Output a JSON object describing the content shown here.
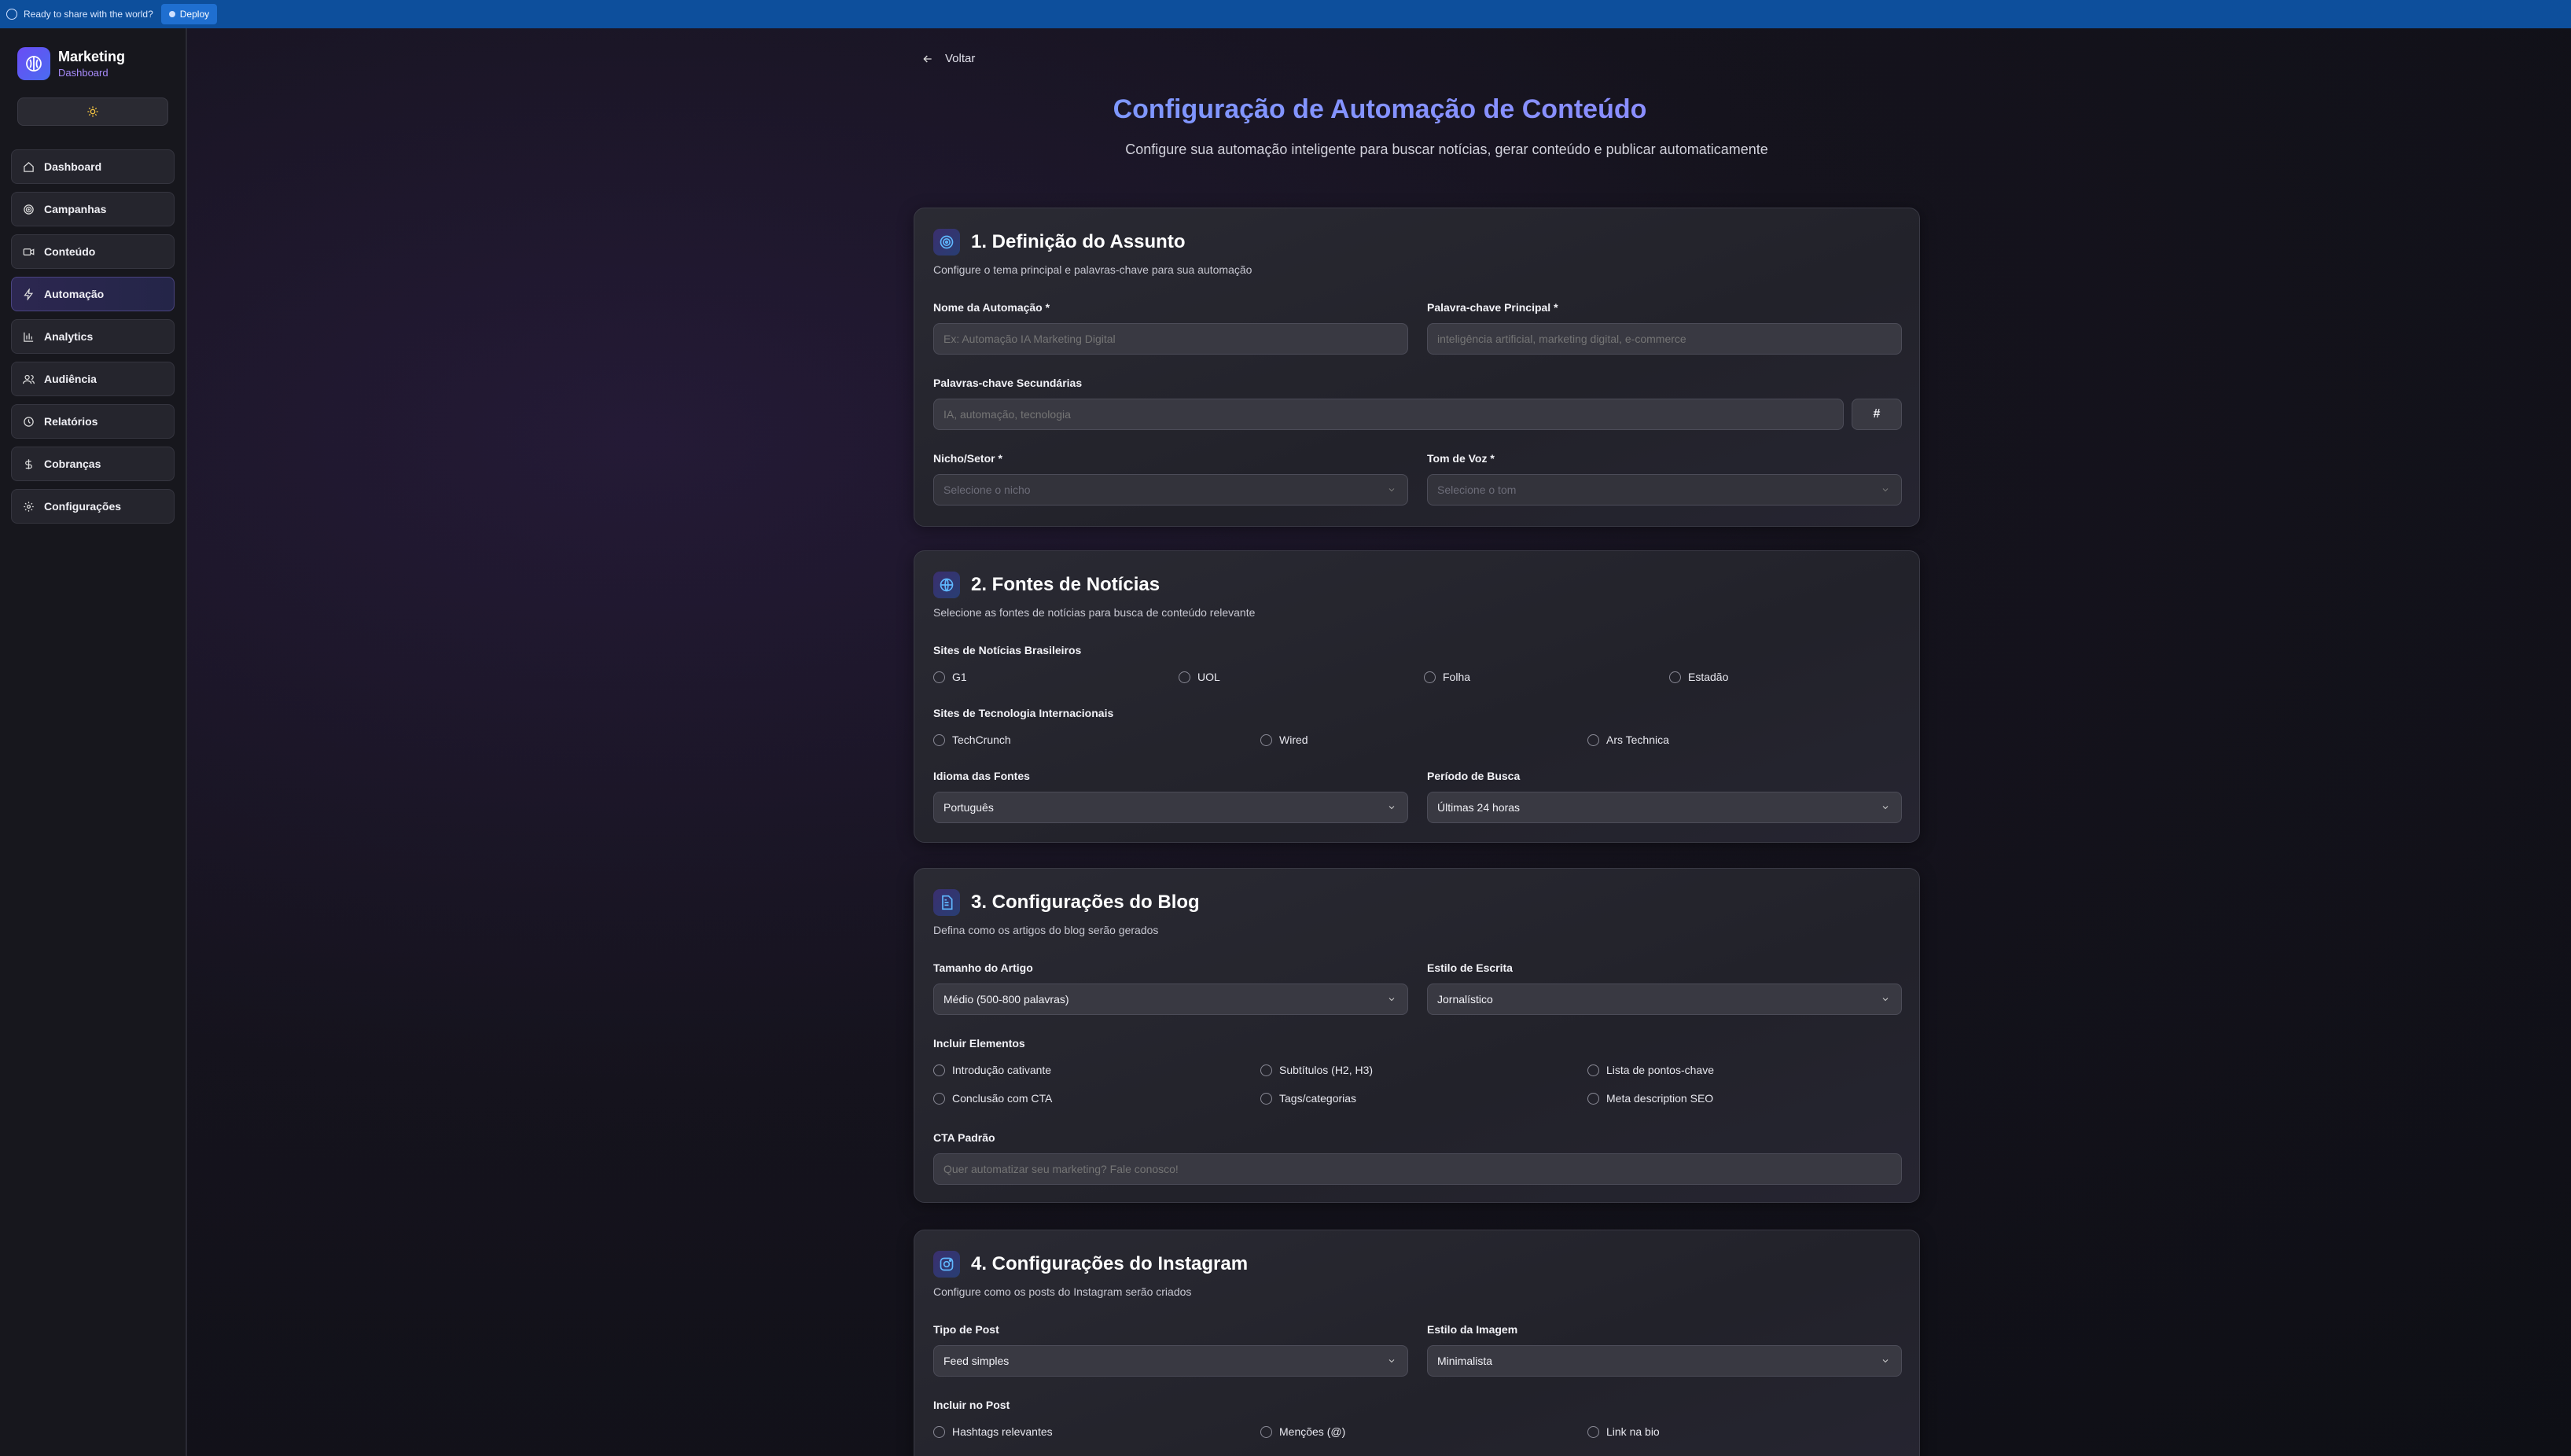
{
  "topbar": {
    "message": "Ready to share with the world?",
    "deploy_label": "Deploy"
  },
  "sidebar": {
    "brand_title": "Marketing",
    "brand_subtitle": "Dashboard",
    "items": [
      {
        "label": "Dashboard",
        "icon": "home-icon"
      },
      {
        "label": "Campanhas",
        "icon": "target-icon"
      },
      {
        "label": "Conteúdo",
        "icon": "video-icon"
      },
      {
        "label": "Automação",
        "icon": "zap-icon"
      },
      {
        "label": "Analytics",
        "icon": "bar-chart-icon"
      },
      {
        "label": "Audiência",
        "icon": "users-icon"
      },
      {
        "label": "Relatórios",
        "icon": "clock-icon"
      },
      {
        "label": "Cobranças",
        "icon": "dollar-icon"
      },
      {
        "label": "Configurações",
        "icon": "gear-icon"
      }
    ],
    "active": "Automação"
  },
  "main": {
    "back_label": "Voltar",
    "title": "Configuração de Automação de Conteúdo",
    "subtitle": "Configure sua automação inteligente para buscar notícias, gerar conteúdo e publicar automaticamente",
    "section1": {
      "title": "1. Definição do Assunto",
      "desc": "Configure o tema principal e palavras-chave para sua automação",
      "name_label": "Nome da Automação *",
      "name_placeholder": "Ex: Automação IA Marketing Digital",
      "keyword_label": "Palavra-chave Principal *",
      "keyword_placeholder": "inteligência artificial, marketing digital, e-commerce",
      "secondary_label": "Palavras-chave Secundárias",
      "secondary_placeholder": "IA, automação, tecnologia",
      "hash_button": "#",
      "niche_label": "Nicho/Setor *",
      "niche_placeholder": "Selecione o nicho",
      "tone_label": "Tom de Voz *",
      "tone_placeholder": "Selecione o tom"
    },
    "section2": {
      "title": "2. Fontes de Notícias",
      "desc": "Selecione as fontes de notícias para busca de conteúdo relevante",
      "br_label": "Sites de Notícias Brasileiros",
      "br_sites": [
        "G1",
        "UOL",
        "Folha",
        "Estadão"
      ],
      "intl_label": "Sites de Tecnologia Internacionais",
      "intl_sites": [
        "TechCrunch",
        "Wired",
        "Ars Technica"
      ],
      "lang_label": "Idioma das Fontes",
      "lang_value": "Português",
      "period_label": "Período de Busca",
      "period_value": "Últimas 24 horas"
    },
    "section3": {
      "title": "3. Configurações do Blog",
      "desc": "Defina como os artigos do blog serão gerados",
      "size_label": "Tamanho do Artigo",
      "size_value": "Médio (500-800 palavras)",
      "style_label": "Estilo de Escrita",
      "style_value": "Jornalístico",
      "elements_label": "Incluir Elementos",
      "elements": [
        "Introdução cativante",
        "Subtítulos (H2, H3)",
        "Lista de pontos-chave",
        "Conclusão com CTA",
        "Tags/categorias",
        "Meta description SEO"
      ],
      "cta_label": "CTA Padrão",
      "cta_placeholder": "Quer automatizar seu marketing? Fale conosco!"
    },
    "section4": {
      "title": "4. Configurações do Instagram",
      "desc": "Configure como os posts do Instagram serão criados",
      "post_type_label": "Tipo de Post",
      "post_type_value": "Feed simples",
      "image_style_label": "Estilo da Imagem",
      "image_style_value": "Minimalista",
      "include_label": "Incluir no Post",
      "include_items": [
        "Hashtags relevantes",
        "Menções (@)",
        "Link na bio"
      ]
    }
  }
}
